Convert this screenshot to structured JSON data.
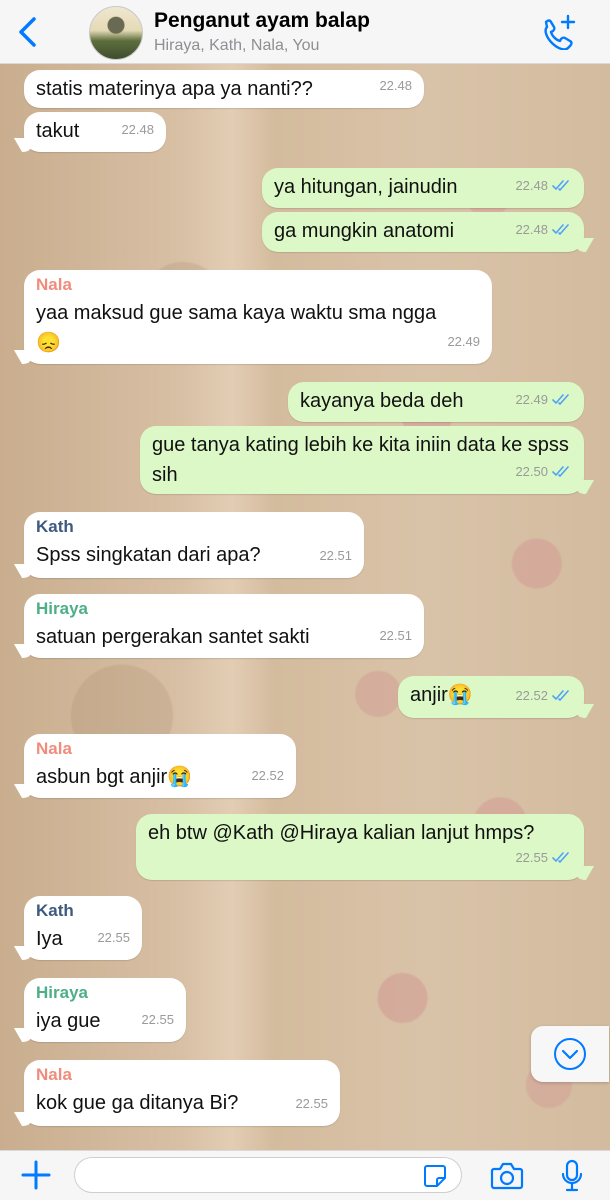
{
  "header": {
    "title": "Penganut ayam balap",
    "members": "Hiraya, Kath, Nala, You"
  },
  "colors": {
    "accent": "#007aff",
    "outgoing_bubble": "#dcf8c6",
    "incoming_bubble": "#ffffff",
    "nala": "#f08c7b",
    "kath": "#3d5a80",
    "hiraya": "#4caf87",
    "ticks": "#4fa3f7"
  },
  "messages": [
    {
      "dir": "in",
      "sender": "",
      "text": "statis materinya apa ya nanti??",
      "time": "22.48"
    },
    {
      "dir": "in",
      "sender": "",
      "text": "takut",
      "time": "22.48"
    },
    {
      "dir": "out",
      "sender": "",
      "text": "ya hitungan, jainudin",
      "time": "22.48",
      "read": true
    },
    {
      "dir": "out",
      "sender": "",
      "text": "ga mungkin anatomi",
      "time": "22.48",
      "read": true
    },
    {
      "dir": "in",
      "sender": "Nala",
      "text": "yaa maksud gue sama kaya waktu sma ngga",
      "emoji": "😞",
      "time": "22.49"
    },
    {
      "dir": "out",
      "sender": "",
      "text": "kayanya beda deh",
      "time": "22.49",
      "read": true
    },
    {
      "dir": "out",
      "sender": "",
      "text": "gue tanya kating lebih ke kita iniin data ke spss sih",
      "time": "22.50",
      "read": true
    },
    {
      "dir": "in",
      "sender": "Kath",
      "text": "Spss singkatan dari apa?",
      "time": "22.51"
    },
    {
      "dir": "in",
      "sender": "Hiraya",
      "text": "satuan pergerakan santet sakti",
      "time": "22.51"
    },
    {
      "dir": "out",
      "sender": "",
      "text": "anjir😭",
      "time": "22.52",
      "read": true
    },
    {
      "dir": "in",
      "sender": "Nala",
      "text": "asbun bgt anjir😭",
      "time": "22.52"
    },
    {
      "dir": "out",
      "sender": "",
      "text": "eh btw @Kath @Hiraya kalian lanjut hmps?",
      "time": "22.55",
      "read": true
    },
    {
      "dir": "in",
      "sender": "Kath",
      "text": "Iya",
      "time": "22.55"
    },
    {
      "dir": "in",
      "sender": "Hiraya",
      "text": "iya gue",
      "time": "22.55"
    },
    {
      "dir": "in",
      "sender": "Nala",
      "text": "kok gue ga ditanya Bi?",
      "time": "22.55"
    }
  ],
  "input": {
    "placeholder": ""
  },
  "icons": {
    "back": "chevron-left-icon",
    "call": "phone-add-icon",
    "scroll": "chevron-down-circle-icon",
    "plus": "plus-icon",
    "sticker": "sticker-icon",
    "camera": "camera-icon",
    "mic": "microphone-icon"
  }
}
